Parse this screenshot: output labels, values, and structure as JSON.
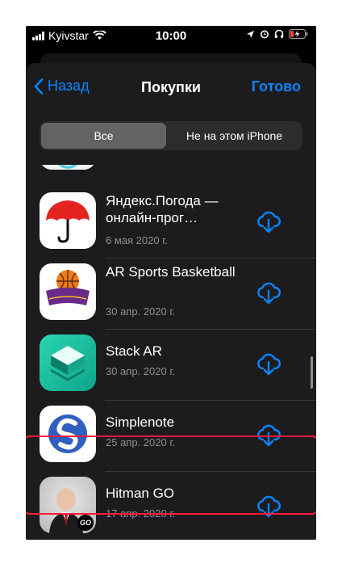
{
  "status_bar": {
    "carrier": "Kyivstar",
    "time": "10:00"
  },
  "nav": {
    "back_label": "Назад",
    "title": "Покупки",
    "done_label": "Готово"
  },
  "segments": {
    "all": "Все",
    "not_on_device": "Не на этом iPhone",
    "selected": "Все"
  },
  "apps": [
    {
      "name": "Яндекс.Погода — онлайн-прог…",
      "date": "6 мая 2020 г.",
      "icon": "umbrella-icon"
    },
    {
      "name": "AR Sports Basketball",
      "date": "30 апр. 2020 г.",
      "icon": "basketball-icon"
    },
    {
      "name": "Stack AR",
      "date": "30 апр. 2020 г.",
      "icon": "stack-icon"
    },
    {
      "name": "Simplenote",
      "date": "25 апр. 2020 г.",
      "icon": "simplenote-icon"
    },
    {
      "name": "Hitman GO",
      "date": "17 апр. 2020 г.",
      "icon": "hitman-icon",
      "icon_badge": "GO"
    }
  ],
  "colors": {
    "accent": "#0a84ff",
    "highlight": "#ff1a3c",
    "background": "#1c1c1e"
  }
}
